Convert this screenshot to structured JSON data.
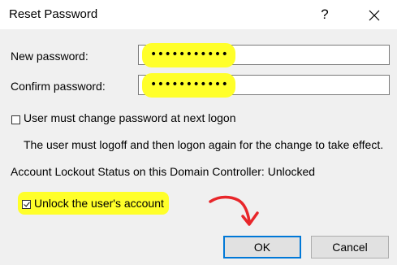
{
  "window": {
    "title": "Reset Password",
    "help_glyph": "?",
    "close_icon": "close-icon"
  },
  "form": {
    "new_password_label": "New password:",
    "new_password_value": "•••••••••••",
    "confirm_password_label": "Confirm password:",
    "confirm_password_value": "•••••••••••",
    "must_change_label": "User must change password at next logon",
    "must_change_checked": false,
    "logoff_note": "The user must logoff and then logon again for the change to take effect.",
    "lockout_status": "Account Lockout Status on this Domain Controller: Unlocked",
    "unlock_label": "Unlock the user's account",
    "unlock_checked": true
  },
  "buttons": {
    "ok": "OK",
    "cancel": "Cancel"
  },
  "colors": {
    "highlight": "#ffff2a",
    "arrow": "#e8262a",
    "dialog_bg": "#f0f0f0",
    "default_button_border": "#0078d7"
  }
}
